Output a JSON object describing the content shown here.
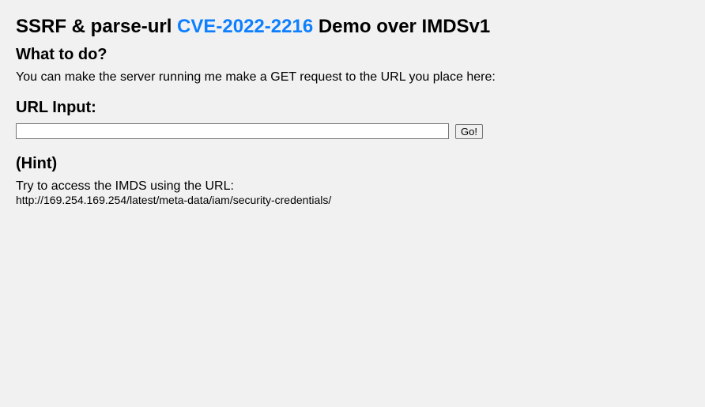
{
  "title": {
    "prefix": "SSRF & parse-url ",
    "cve_link_text": "CVE-2022-2216",
    "suffix": " Demo over IMDSv1"
  },
  "what_to_do": {
    "heading": "What to do?",
    "description": "You can make the server running me make a GET request to the URL you place here:"
  },
  "url_input": {
    "heading": "URL Input:",
    "value": "",
    "button_label": "Go!"
  },
  "hint": {
    "heading": "(Hint)",
    "description": "Try to access the IMDS using the URL:",
    "url": "http://169.254.169.254/latest/meta-data/iam/security-credentials/"
  }
}
